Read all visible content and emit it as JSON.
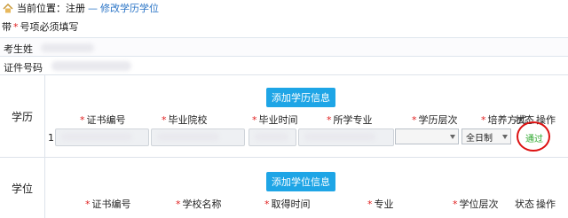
{
  "breadcrumb": {
    "current_label": "当前位置：注册",
    "separator": "—",
    "link": "修改学历学位"
  },
  "note": {
    "prefix": "带",
    "star": "*",
    "text": "号项必须填写"
  },
  "fields": {
    "examinee_label": "考生姓",
    "id_label": "证件号码"
  },
  "education": {
    "section_label": "学历",
    "add_button": "添加学历信息",
    "columns": [
      "证书编号",
      "毕业院校",
      "毕业时间",
      "所学专业",
      "学历层次",
      "培养方式",
      "状态",
      "操作"
    ],
    "required": [
      true,
      true,
      true,
      true,
      true,
      true,
      false,
      false
    ],
    "rows": [
      {
        "index": "1:",
        "study_mode": "全日制",
        "action": "通过"
      }
    ]
  },
  "degree": {
    "section_label": "学位",
    "add_button": "添加学位信息",
    "columns": [
      "证书编号",
      "学校名称",
      "取得时间",
      "专业",
      "学位层次",
      "状态",
      "操作"
    ],
    "required": [
      true,
      true,
      true,
      true,
      true,
      false,
      false
    ]
  },
  "colors": {
    "link": "#2a74c6",
    "button": "#1ea5e6",
    "required": "#e02020",
    "pass": "#2fa82f",
    "highlight": "#d11111"
  }
}
